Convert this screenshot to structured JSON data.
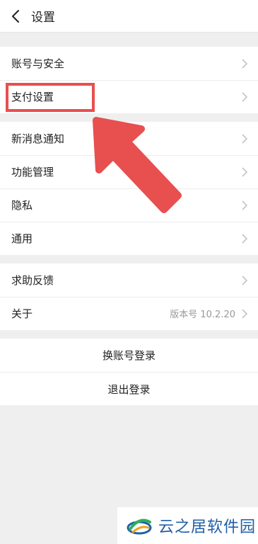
{
  "header": {
    "title": "设置"
  },
  "groups": {
    "account": {
      "items": [
        {
          "label": "账号与安全"
        },
        {
          "label": "支付设置"
        }
      ]
    },
    "general": {
      "items": [
        {
          "label": "新消息通知"
        },
        {
          "label": "功能管理"
        },
        {
          "label": "隐私"
        },
        {
          "label": "通用"
        }
      ]
    },
    "help": {
      "items": [
        {
          "label": "求助反馈"
        },
        {
          "label": "关于",
          "value": "版本号 10.2.20"
        }
      ]
    }
  },
  "actions": {
    "switch_account": "换账号登录",
    "logout": "退出登录"
  },
  "annotation": {
    "color": "#e84f4f"
  },
  "watermark": {
    "text": "云之居软件园"
  }
}
